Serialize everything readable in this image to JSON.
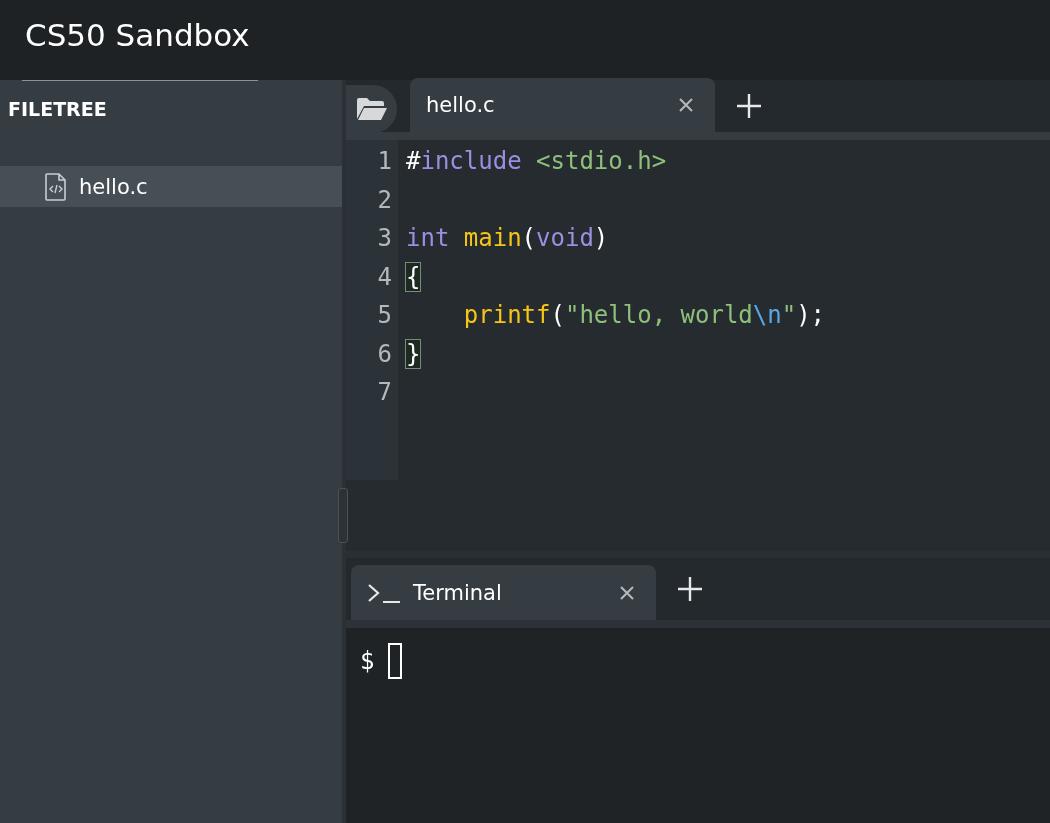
{
  "header": {
    "title": "CS50 Sandbox"
  },
  "filetree": {
    "heading": "FILETREE",
    "items": [
      {
        "name": "hello.c",
        "selected": true
      }
    ]
  },
  "editor": {
    "tabs": [
      {
        "label": "hello.c",
        "selected": true
      }
    ],
    "lines": [
      {
        "number": "1",
        "tokens": [
          {
            "kind": "plain",
            "text": "#"
          },
          {
            "kind": "keyword",
            "text": "include"
          },
          {
            "kind": "string",
            "text": " <stdio.h>"
          }
        ]
      },
      {
        "number": "2"
      },
      {
        "number": "3",
        "tokens": [
          {
            "kind": "keyword",
            "text": "int"
          },
          {
            "kind": "function",
            "text": " main"
          },
          {
            "kind": "plain",
            "text": "("
          },
          {
            "kind": "keyword",
            "text": "void"
          },
          {
            "kind": "plain",
            "text": ")"
          }
        ]
      },
      {
        "number": "4",
        "tokens": [
          {
            "kind": "matched-bracket",
            "text": "{"
          }
        ]
      },
      {
        "number": "5",
        "tokens": [
          {
            "kind": "function",
            "text": "    printf"
          },
          {
            "kind": "plain",
            "text": "("
          },
          {
            "kind": "string",
            "text": "\"hello, world"
          },
          {
            "kind": "escape",
            "text": "\\n"
          },
          {
            "kind": "string",
            "text": "\""
          },
          {
            "kind": "plain",
            "text": ");"
          }
        ]
      },
      {
        "number": "6",
        "tokens": [
          {
            "kind": "matched-bracket",
            "text": "}"
          }
        ]
      },
      {
        "number": "7"
      }
    ]
  },
  "terminal": {
    "tabs": [
      {
        "label": "Terminal",
        "selected": true
      }
    ],
    "prompt": "$"
  }
}
